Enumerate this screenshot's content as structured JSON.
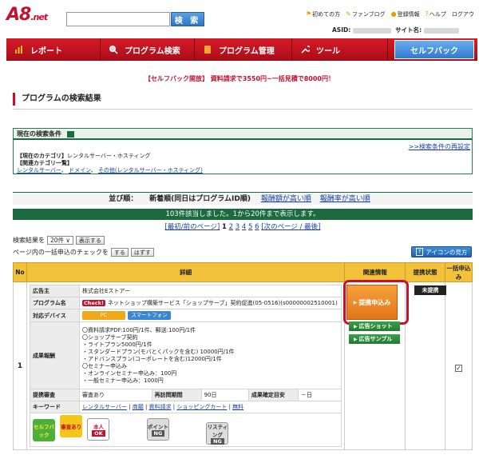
{
  "header": {
    "logo_main": "A8",
    "logo_sub": ".net",
    "search_button": "検 索",
    "links": [
      {
        "icon": "flag-icon",
        "glyph": "⚑",
        "label": "初めての方"
      },
      {
        "icon": "blog-icon",
        "glyph": "✎",
        "label": "ファンブログ"
      },
      {
        "icon": "user-icon",
        "glyph": "●",
        "label": "登録情報"
      },
      {
        "icon": "help-icon",
        "glyph": "?",
        "label": "ヘルプ"
      },
      {
        "icon": "logout-icon",
        "glyph": "",
        "label": "ログアウ"
      }
    ],
    "asid_label": "ASID:",
    "site_label": "サイト名:"
  },
  "nav": {
    "items": [
      {
        "label": "レポート",
        "icon": "report-chart-icon"
      },
      {
        "label": "プログラム検索",
        "icon": "program-search-icon"
      },
      {
        "label": "プログラム管理",
        "icon": "program-manage-icon"
      },
      {
        "label": "ツール",
        "icon": "tool-wrench-icon"
      }
    ],
    "selfback": "セルフバック"
  },
  "promo": "【セルフバック開放】 資料請求で3550円~一括見積で8000円！",
  "page_title": "プログラムの検索結果",
  "conditions": {
    "header": "現在の検索条件",
    "reset": ">>検索条件の再設定",
    "current_category_label": "【現在のカテゴリ】",
    "current_category": "レンタルサーバー・ホスティング",
    "related_label": "【関連カテゴリ一覧】",
    "related": [
      "レンタルサーバー",
      "ドメイン",
      "その他(レンタルサーバー・ホスティング)"
    ]
  },
  "sort": {
    "label": "並び順：",
    "current": "新着順(同日はプログラムID順)",
    "options": [
      "報酬額が高い順",
      "報酬率が高い順"
    ]
  },
  "hits": "103件該当しました。1から20件まで表示します。",
  "pager": {
    "prev": "[最初/前のページ]",
    "pages": [
      "1",
      "2",
      "3",
      "4",
      "5",
      "6"
    ],
    "next": "[次のページ / 最後]"
  },
  "list_controls": {
    "results_label": "検索結果を",
    "per_page": "20件 ∨",
    "show_button": "表示する",
    "bulk_label": "ページ内の一括申込のチェックを",
    "check_button": "する",
    "uncheck_button": "はずす",
    "icon_guide": "アイコンの見方"
  },
  "table": {
    "headers": {
      "no": "No",
      "detail": "詳細",
      "related": "関連情報",
      "status": "提携状態",
      "bulk": "一括申込み"
    },
    "row": {
      "no": "1",
      "advertiser_label": "広告主",
      "advertiser": "株式会社Eストアー",
      "program_label": "プログラム名",
      "check_badge": "Check!",
      "program": "ネットショップ構築サービス「ショップサーブ」契約促進(05-0516)(s00000002510001)",
      "device_label": "対応デバイス",
      "devices": [
        "PC",
        "スマートフォン"
      ],
      "reward_label": "成果報酬",
      "rewards": [
        "〇資料請求PDF:100円/1件、郵送:100円/1件",
        "〇ショップサーブ契約",
        "・ライトプラン5000円/1件",
        "・スタンダードプラン(モバとくパックを含む) 10000円/1件",
        "・アドバンスプラン(コーポレートを含む)12000円/1件",
        "〇セミナー申込み",
        "・オンラインセミナー申込み：100円",
        "・一般セミナー申込み：1000円"
      ],
      "review_label": "提携審査",
      "review": "審査あり",
      "period_label": "再訪問期間",
      "period": "90日",
      "confirm_label": "成果確定目安",
      "confirm": "－日",
      "keyword_label": "キーワード",
      "keywords": [
        "レンタルサーバー",
        "商願",
        "資料請求",
        "ショッピングカート",
        "無料"
      ],
      "badges": {
        "selfback": "セルフバック",
        "review": "審査あり",
        "self_label": "本人",
        "self_value": "OK",
        "point_label": "ポイント",
        "point_value": "NG",
        "listing_label": "リスティング",
        "listing_value": "NG"
      },
      "apply_button": "提携申込み",
      "green_buttons": [
        "広告ショット",
        "広告サンプル"
      ],
      "status": "未提携",
      "checked": "✓"
    }
  }
}
